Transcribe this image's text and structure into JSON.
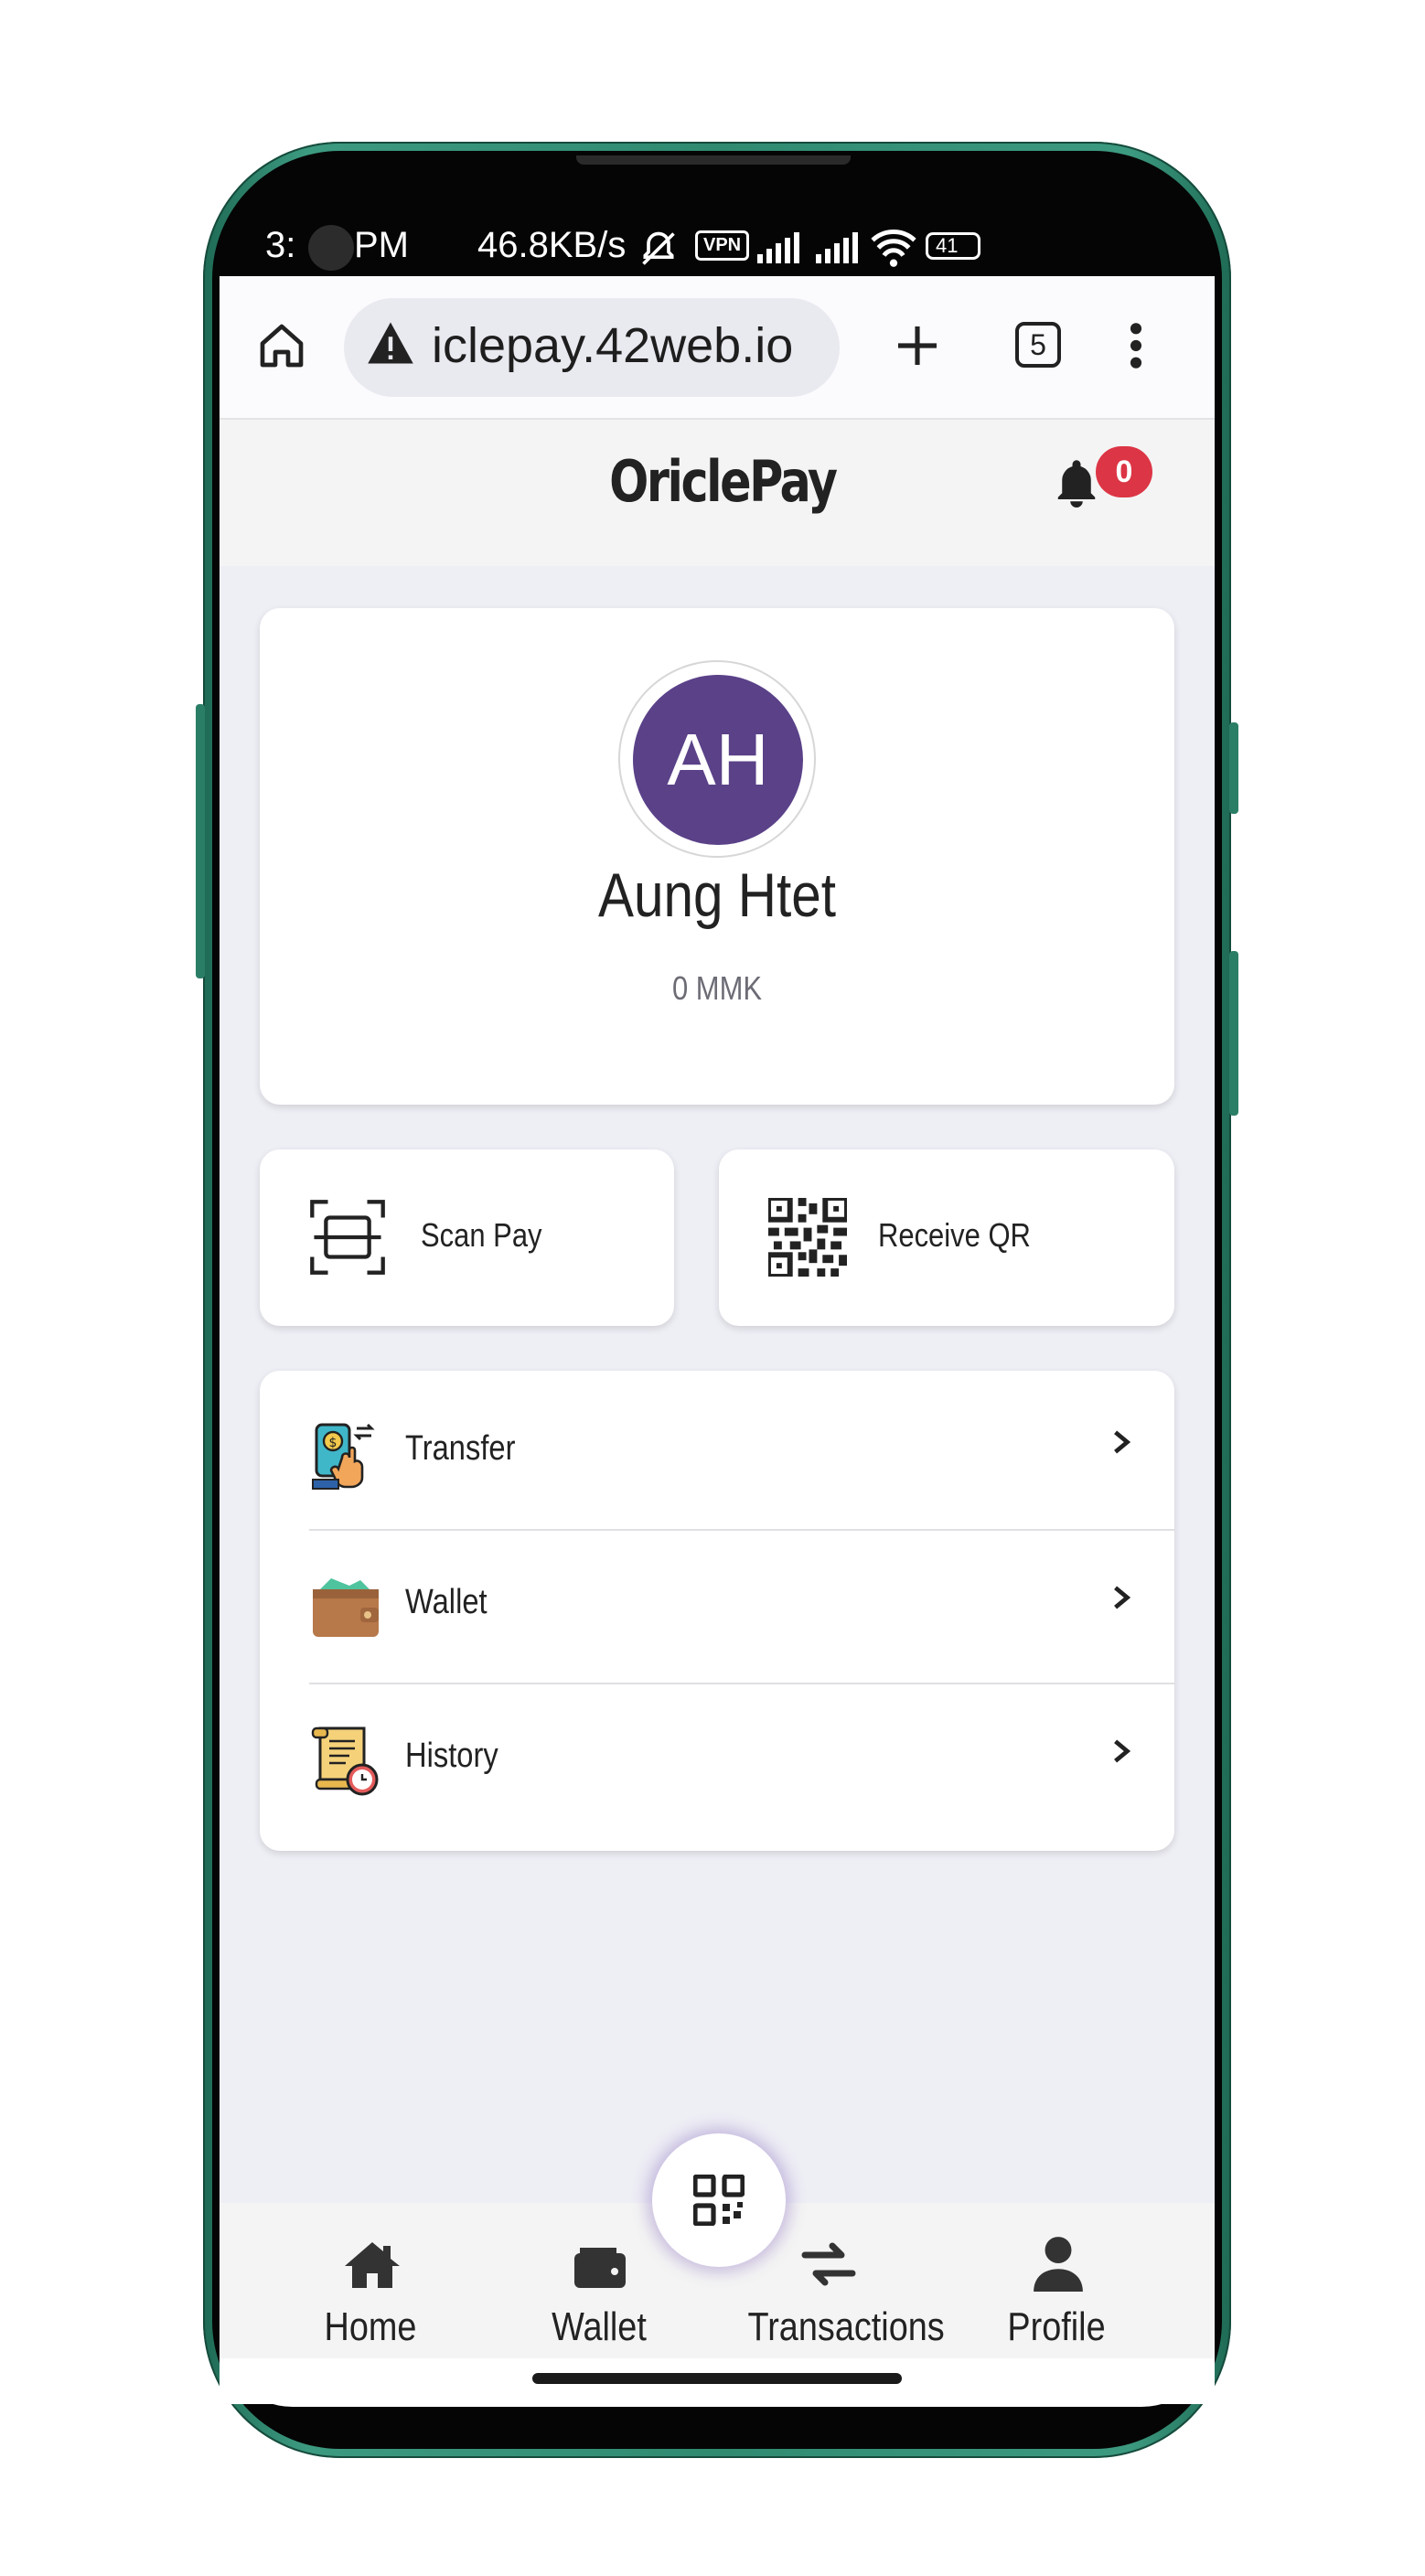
{
  "status_bar": {
    "time": "3:",
    "time_suffix": "PM",
    "network_speed": "46.8KB/s",
    "vpn": "VPN",
    "battery": "41"
  },
  "browser": {
    "url": "iclepay.42web.io",
    "tab_count": "5"
  },
  "app": {
    "title": "OriclePay",
    "notification_count": "0"
  },
  "profile": {
    "initials": "AH",
    "name": "Aung Htet",
    "balance": "0 MMK"
  },
  "quick_actions": {
    "scan_pay": "Scan Pay",
    "receive_qr": "Receive QR"
  },
  "menu": {
    "items": [
      {
        "label": "Transfer",
        "icon": "transfer-icon"
      },
      {
        "label": "Wallet",
        "icon": "wallet-icon"
      },
      {
        "label": "History",
        "icon": "history-icon"
      }
    ]
  },
  "bottom_nav": {
    "items": [
      {
        "label": "Home",
        "icon": "home-icon"
      },
      {
        "label": "Wallet",
        "icon": "wallet-icon"
      },
      {
        "label": "Transactions",
        "icon": "transactions-icon"
      },
      {
        "label": "Profile",
        "icon": "profile-icon"
      }
    ]
  },
  "colors": {
    "avatar": "#5a4188",
    "badge": "#dc3545",
    "frame": "#2f8a70"
  }
}
